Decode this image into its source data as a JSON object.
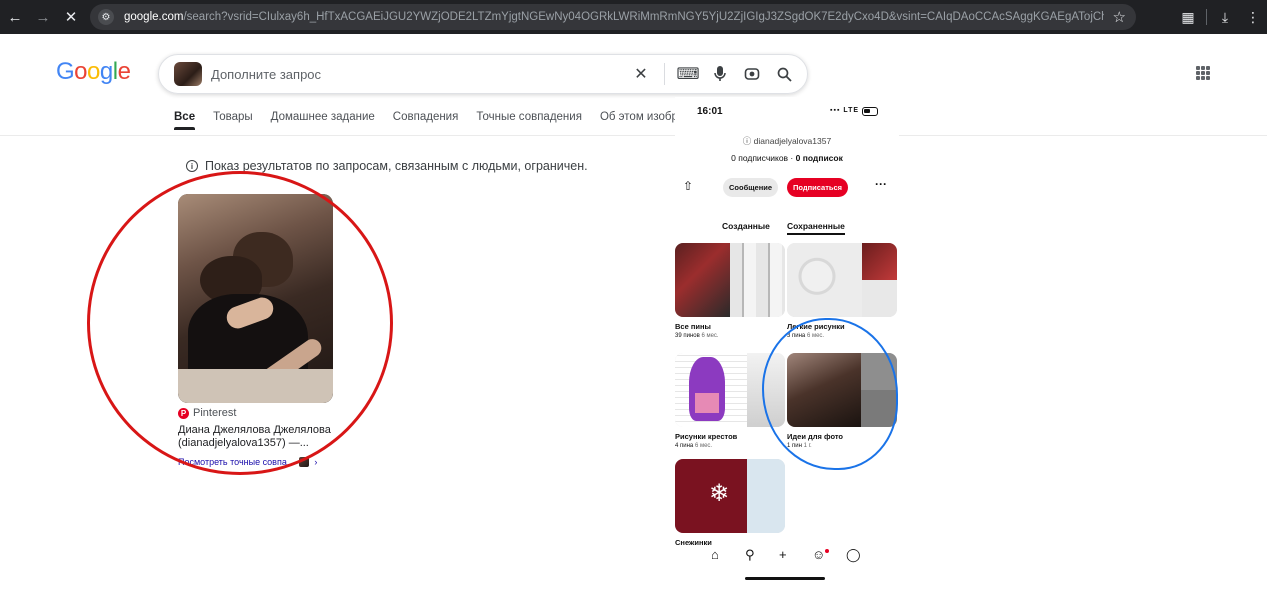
{
  "browser": {
    "url_host": "google.com",
    "url_rest": "/search?vsrid=CIulxay6h_HfTxACGAEiJGU2YWZjODE2LTZmYjgtNGEwNy04OGRkLWRiMmRmNGY5YjU2ZjIGIgJ3ZSgdOK7E2dyCxo4D&vsint=CAIqDAoCCAcSAggKGAEgATojChYNAAAAPxUAAAA_HQAA..."
  },
  "google": {
    "search_placeholder": "Дополните запрос",
    "tabs": [
      "Все",
      "Товары",
      "Домашнее задание",
      "Совпадения",
      "Точные совпадения",
      "Об этом изображ"
    ],
    "notice": "Показ результатов по запросам, связанным с людьми, ограничен.",
    "result": {
      "source": "Pinterest",
      "title": "Диана Джелялова Джелялова (dianadjelyalova1357) —...",
      "link": "Посмотреть точные совпа..."
    }
  },
  "phone": {
    "time": "16:01",
    "signal": "LTE",
    "handle": "dianadjelyalova1357",
    "followers": "0 подписчиков",
    "following": "0 подписок",
    "message_button": "Сообщение",
    "subscribe_button": "Подписаться",
    "tabs": [
      "Созданные",
      "Сохраненные"
    ],
    "boards": [
      {
        "name": "Все пины",
        "count": "39 пинов",
        "age": "6 мес."
      },
      {
        "name": "Легкие рисунки",
        "count": "3 пина",
        "age": "6 мес."
      },
      {
        "name": "Рисунки крестов",
        "count": "4 пина",
        "age": "6 мес."
      },
      {
        "name": "Идеи для фото",
        "count": "1 пин",
        "age": "1 г."
      },
      {
        "name": "Снежинки",
        "count": "",
        "age": ""
      }
    ]
  }
}
